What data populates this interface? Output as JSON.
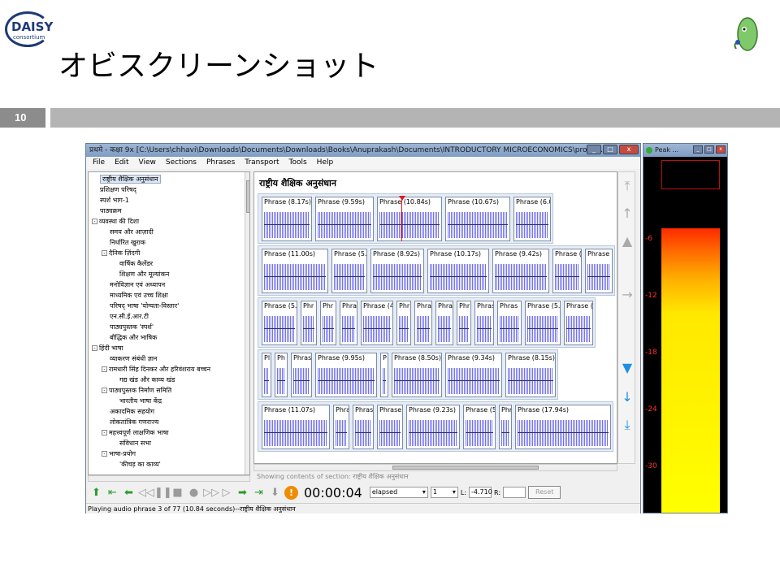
{
  "slide": {
    "logo_text": "DAISY",
    "logo_sub": "consortium",
    "title": "オビスクリーンショット",
    "page_number": "10"
  },
  "window": {
    "title": "प्रथमे - कक्षा 9x [C:\\Users\\chhavi\\Downloads\\Documents\\Downloads\\Books\\Anuprakash\\Documents\\INTRODUCTORY MICROECONOMICS\\project.obi] - Obi",
    "menu": [
      "File",
      "Edit",
      "View",
      "Sections",
      "Phrases",
      "Transport",
      "Tools",
      "Help"
    ]
  },
  "tree": {
    "items": [
      {
        "label": "राष्ट्रीय शैक्षिक अनुसंधान",
        "level": 0,
        "selected": true
      },
      {
        "label": "प्रशिक्षण परिषद्",
        "level": 0
      },
      {
        "label": "स्पर्श भाग-1",
        "level": 0
      },
      {
        "label": "पाठ्यक्रम",
        "level": 0
      },
      {
        "label": "व्यवस्था की दिशा",
        "level": 0,
        "expander": "-"
      },
      {
        "label": "समय और आज़ादी",
        "level": 1
      },
      {
        "label": "निर्धारित खुराक",
        "level": 1
      },
      {
        "label": "दैनिक ज़िंदगी",
        "level": 1,
        "expander": "-"
      },
      {
        "label": "वार्षिक कैलेंडर",
        "level": 2
      },
      {
        "label": "शिक्षण और मूल्यांकन",
        "level": 2
      },
      {
        "label": "मनोविज्ञान एवं अध्यापन",
        "level": 1
      },
      {
        "label": "माध्यमिक एवं उच्च शिक्षा",
        "level": 1
      },
      {
        "label": "परिषद् भाषा 'योग्यता-विस्तार'",
        "level": 1
      },
      {
        "label": "एन.सी.ई.आर.टी",
        "level": 1
      },
      {
        "label": "पाठ्यपुस्तक 'स्पर्श'",
        "level": 1
      },
      {
        "label": "बौद्धिक और भाषिक",
        "level": 1
      },
      {
        "label": "हिंदी भाषा",
        "level": 0,
        "expander": "-"
      },
      {
        "label": "व्याकरण संबंधी ज्ञान",
        "level": 1
      },
      {
        "label": "रामधारी सिंह दिनकर और हरिवंशराय बच्चन",
        "level": 1,
        "expander": "-"
      },
      {
        "label": "गद्य खंड और काव्य खंड",
        "level": 2
      },
      {
        "label": "पाठ्यपुस्तक निर्माण समिति",
        "level": 1,
        "expander": "-"
      },
      {
        "label": "भारतीय भाषा केंद्र",
        "level": 2
      },
      {
        "label": "अकादमिक सहयोग",
        "level": 1
      },
      {
        "label": "लोकतांत्रिक गणराज्य",
        "level": 1
      },
      {
        "label": "महत्त्वपूर्ण लाक्षणिक भाषा",
        "level": 1,
        "expander": "-"
      },
      {
        "label": "संविधान सभा",
        "level": 2
      },
      {
        "label": "भाषा-प्रयोग",
        "level": 1,
        "expander": "-"
      },
      {
        "label": "'कीचड़ का काव्य'",
        "level": 2
      }
    ]
  },
  "content": {
    "section_title": "राष्ट्रीय शैक्षिक अनुसंधान",
    "strips": [
      [
        {
          "label": "Phrase (8.17s)",
          "w": 62
        },
        {
          "label": "Phrase (9.59s)",
          "w": 72
        },
        {
          "label": "Phrase (10.84s)",
          "w": 80
        },
        {
          "label": "Phrase (10.67s)",
          "w": 80
        },
        {
          "label": "Phrase (6.0",
          "w": 46
        }
      ],
      [
        {
          "label": "Phrase (11.00s)",
          "w": 82
        },
        {
          "label": "Phrase (5.7",
          "w": 44
        },
        {
          "label": "Phrase (8.92s)",
          "w": 66
        },
        {
          "label": "Phrase (10.17s)",
          "w": 76
        },
        {
          "label": "Phrase (9.42s)",
          "w": 70
        },
        {
          "label": "Phrase (4",
          "w": 36
        },
        {
          "label": "Phrase",
          "w": 34
        }
      ],
      [
        {
          "label": "Phrase (5.0",
          "w": 44
        },
        {
          "label": "Phr",
          "w": 20
        },
        {
          "label": "Phr",
          "w": 20
        },
        {
          "label": "Phra",
          "w": 22
        },
        {
          "label": "Phrase (4",
          "w": 40
        },
        {
          "label": "Phr",
          "w": 18
        },
        {
          "label": "Phra",
          "w": 22
        },
        {
          "label": "Phra",
          "w": 22
        },
        {
          "label": "Phr",
          "w": 18
        },
        {
          "label": "Phras",
          "w": 24
        },
        {
          "label": "Phras",
          "w": 30
        },
        {
          "label": "Phrase (5.0",
          "w": 44
        },
        {
          "label": "Phrase (4",
          "w": 36
        }
      ],
      [
        {
          "label": "Pl",
          "w": 12
        },
        {
          "label": "Ph",
          "w": 16
        },
        {
          "label": "Phras",
          "w": 26
        },
        {
          "label": "Phrase (9.95s)",
          "w": 76
        },
        {
          "label": "P",
          "w": 10
        },
        {
          "label": "Phrase (8.50s)",
          "w": 62
        },
        {
          "label": "Phrase (9.34s)",
          "w": 70
        },
        {
          "label": "Phrase (8.15s)",
          "w": 62
        }
      ],
      [
        {
          "label": "Phrase (11.07s)",
          "w": 84
        },
        {
          "label": "Phra",
          "w": 20
        },
        {
          "label": "Phras",
          "w": 26
        },
        {
          "label": "Phrase",
          "w": 32
        },
        {
          "label": "Phrase (9.23s)",
          "w": 66
        },
        {
          "label": "Phrase (5",
          "w": 40
        },
        {
          "label": "Phr",
          "w": 16
        },
        {
          "label": "Phrase (17.94s)",
          "w": 118
        }
      ]
    ],
    "showing_label": "Showing contents of section:  राष्ट्रीय शैक्षिक अनुसंधान"
  },
  "transport": {
    "time": "00:00:04",
    "time_mode": "elapsed",
    "phrase_count": "1",
    "l_label": "L:",
    "l_value": "-4.710",
    "r_label": "R:",
    "r_value": "",
    "reset_label": "Reset"
  },
  "statusbar": {
    "text": "Playing audio phrase 3 of 77 (10.84 seconds)--राष्ट्रीय शैक्षिक अनुसंधान"
  },
  "peak_meter": {
    "title": "Peak ...",
    "ticks": [
      "-6",
      "-12",
      "-18",
      "-24",
      "-30"
    ],
    "level_db": -5
  }
}
